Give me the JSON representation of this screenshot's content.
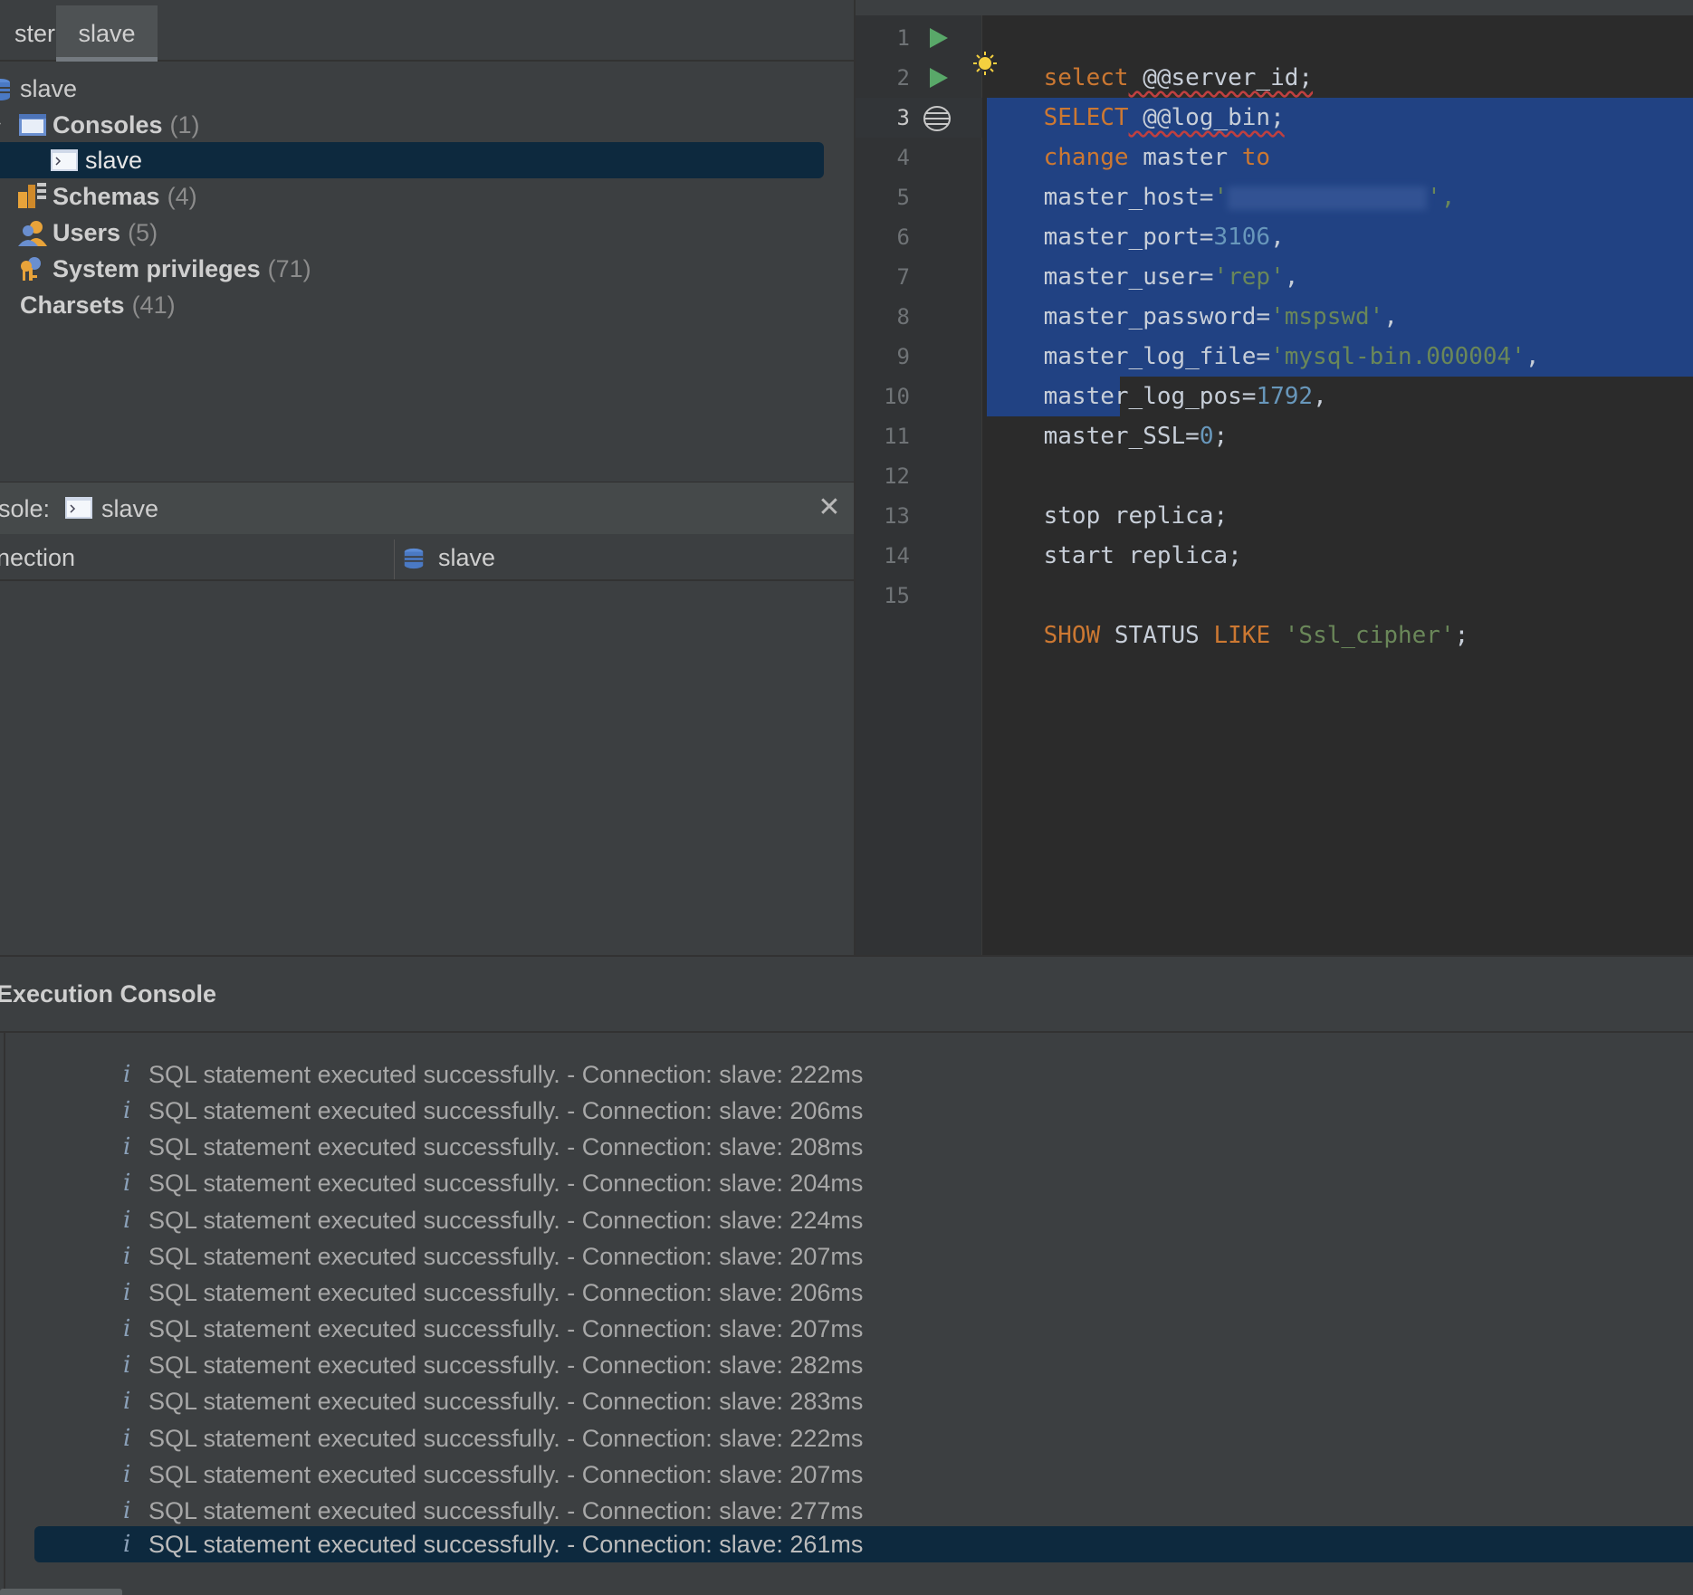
{
  "tabs": [
    {
      "label": "ster"
    },
    {
      "label": "slave"
    }
  ],
  "explorer": {
    "root": {
      "label": "slave"
    },
    "consoles": {
      "label": "Consoles",
      "count": "(1)"
    },
    "consoles_child": {
      "label": "slave"
    },
    "schemas": {
      "label": "Schemas",
      "count": "(4)"
    },
    "users": {
      "label": "Users",
      "count": "(5)"
    },
    "privileges": {
      "label": "System privileges",
      "count": "(71)"
    },
    "charsets": {
      "label": "Charsets",
      "count": "(41)"
    }
  },
  "console_panel": {
    "label": "sole:",
    "console_name": "slave",
    "close_glyph": "✕",
    "connection_label": "nection",
    "connection_value": "slave"
  },
  "editor": {
    "line_numbers": [
      "1",
      "2",
      "3",
      "4",
      "5",
      "6",
      "7",
      "8",
      "9",
      "10",
      "11",
      "12",
      "13",
      "14",
      "15"
    ],
    "current_line": "3",
    "lines": {
      "l1": {
        "kw": "select",
        "rest": " @@server_id;"
      },
      "l2": {
        "kw": "SELECT",
        "rest": " @@log_bin;"
      },
      "l3": {
        "kw1": "change",
        "mid": " master ",
        "kw2": "to"
      },
      "l4": {
        "key": "master_host=",
        "str_open": "'",
        "str_close": "',"
      },
      "l5": {
        "key": "master_port=",
        "num": "3106",
        "end": ","
      },
      "l6": {
        "key": "master_user=",
        "str": "'rep'",
        "end": ","
      },
      "l7": {
        "key": "master_password=",
        "str": "'mspswd'",
        "end": ","
      },
      "l8": {
        "key": "master_log_file=",
        "str": "'mysql-bin.000004'",
        "end": ","
      },
      "l9": {
        "key": "master_log_pos=",
        "num": "1792",
        "end": ","
      },
      "l10": {
        "key": "master_SSL=",
        "num": "0",
        "end": ";"
      },
      "l12": {
        "text": "stop replica;"
      },
      "l13": {
        "text": "start replica;"
      },
      "l15": {
        "kw1": "SHOW",
        "mid": " STATUS ",
        "kw2": "LIKE",
        "sp": " ",
        "str": "'Ssl_cipher'",
        "end": ";"
      }
    }
  },
  "execution_console": {
    "title": "Execution Console",
    "info_glyph": "i",
    "messages": [
      "SQL statement executed successfully. - Connection: slave: 222ms",
      "SQL statement executed successfully. - Connection: slave: 206ms",
      "SQL statement executed successfully. - Connection: slave: 208ms",
      "SQL statement executed successfully. - Connection: slave: 204ms",
      "SQL statement executed successfully. - Connection: slave: 224ms",
      "SQL statement executed successfully. - Connection: slave: 207ms",
      "SQL statement executed successfully. - Connection: slave: 206ms",
      "SQL statement executed successfully. - Connection: slave: 207ms",
      "SQL statement executed successfully. - Connection: slave: 282ms",
      "SQL statement executed successfully. - Connection: slave: 283ms",
      "SQL statement executed successfully. - Connection: slave: 222ms",
      "SQL statement executed successfully. - Connection: slave: 207ms",
      "SQL statement executed successfully. - Connection: slave: 277ms",
      "SQL statement executed successfully. - Connection: slave: 261ms"
    ]
  },
  "colors": {
    "keyword": "#cc7832",
    "string": "#6a8759",
    "number": "#6897bb",
    "selection": "#214283",
    "selected_row": "#0d293e",
    "run_icon": "#59a869"
  }
}
